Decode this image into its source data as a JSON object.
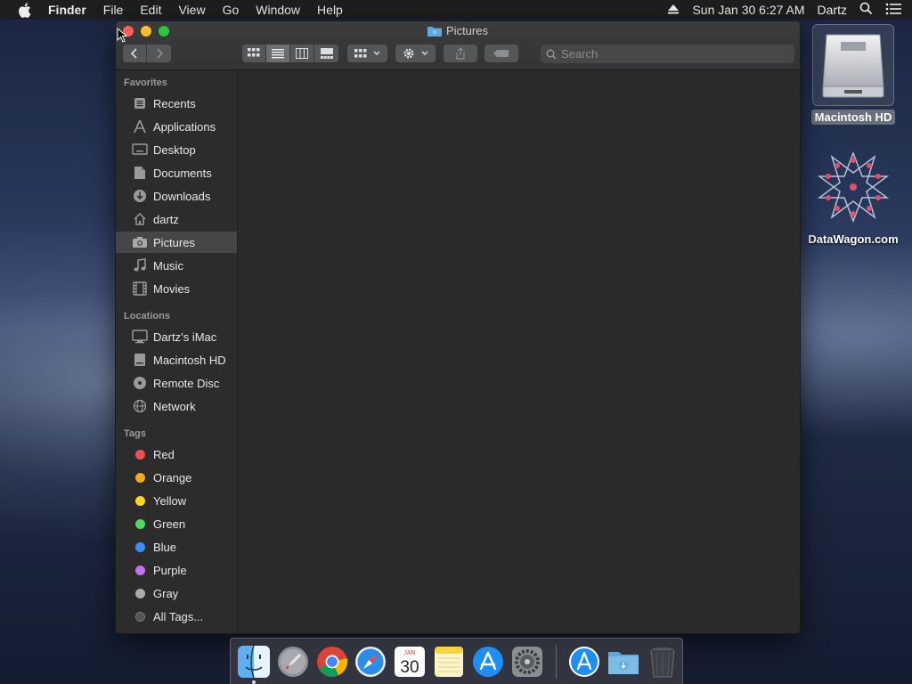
{
  "menubar": {
    "apple": "apple-logo-icon",
    "app_name": "Finder",
    "items": [
      "File",
      "Edit",
      "View",
      "Go",
      "Window",
      "Help"
    ],
    "datetime": "Sun Jan 30  6:27 AM",
    "user": "Dartz"
  },
  "desktop": {
    "icons": [
      {
        "label": "Macintosh HD",
        "icon": "hard-drive-icon"
      },
      {
        "label": "DataWagon.com",
        "icon": "datawagon-logo-icon"
      }
    ]
  },
  "window": {
    "title": "Pictures",
    "search_placeholder": "Search"
  },
  "sidebar": {
    "favorites_title": "Favorites",
    "favorites": [
      {
        "label": "Recents",
        "icon": "clock-icon"
      },
      {
        "label": "Applications",
        "icon": "applications-icon"
      },
      {
        "label": "Desktop",
        "icon": "desktop-icon"
      },
      {
        "label": "Documents",
        "icon": "document-icon"
      },
      {
        "label": "Downloads",
        "icon": "download-icon"
      },
      {
        "label": "dartz",
        "icon": "home-icon"
      },
      {
        "label": "Pictures",
        "icon": "camera-icon",
        "selected": true
      },
      {
        "label": "Music",
        "icon": "music-icon"
      },
      {
        "label": "Movies",
        "icon": "film-icon"
      }
    ],
    "locations_title": "Locations",
    "locations": [
      {
        "label": "Dartz’s iMac",
        "icon": "imac-icon"
      },
      {
        "label": "Macintosh HD",
        "icon": "hard-drive-icon"
      },
      {
        "label": "Remote Disc",
        "icon": "disc-icon"
      },
      {
        "label": "Network",
        "icon": "globe-icon"
      }
    ],
    "tags_title": "Tags",
    "tags": [
      {
        "label": "Red",
        "color": "#f0504f"
      },
      {
        "label": "Orange",
        "color": "#f5a623"
      },
      {
        "label": "Yellow",
        "color": "#f8d81c"
      },
      {
        "label": "Green",
        "color": "#4cd964"
      },
      {
        "label": "Blue",
        "color": "#3c8ef6"
      },
      {
        "label": "Purple",
        "color": "#c471ed"
      },
      {
        "label": "Gray",
        "color": "#aaaaaa"
      },
      {
        "label": "All Tags...",
        "color": "#555555"
      }
    ]
  },
  "dock": {
    "apps": [
      "finder-icon",
      "launchpad-icon",
      "chrome-icon",
      "safari-icon",
      "calendar-icon",
      "notes-icon",
      "app-store-icon",
      "system-preferences-icon"
    ],
    "calendar": {
      "month": "JAN",
      "day": "30"
    },
    "stacks": [
      "applications-folder-icon",
      "downloads-folder-icon",
      "trash-icon"
    ]
  }
}
